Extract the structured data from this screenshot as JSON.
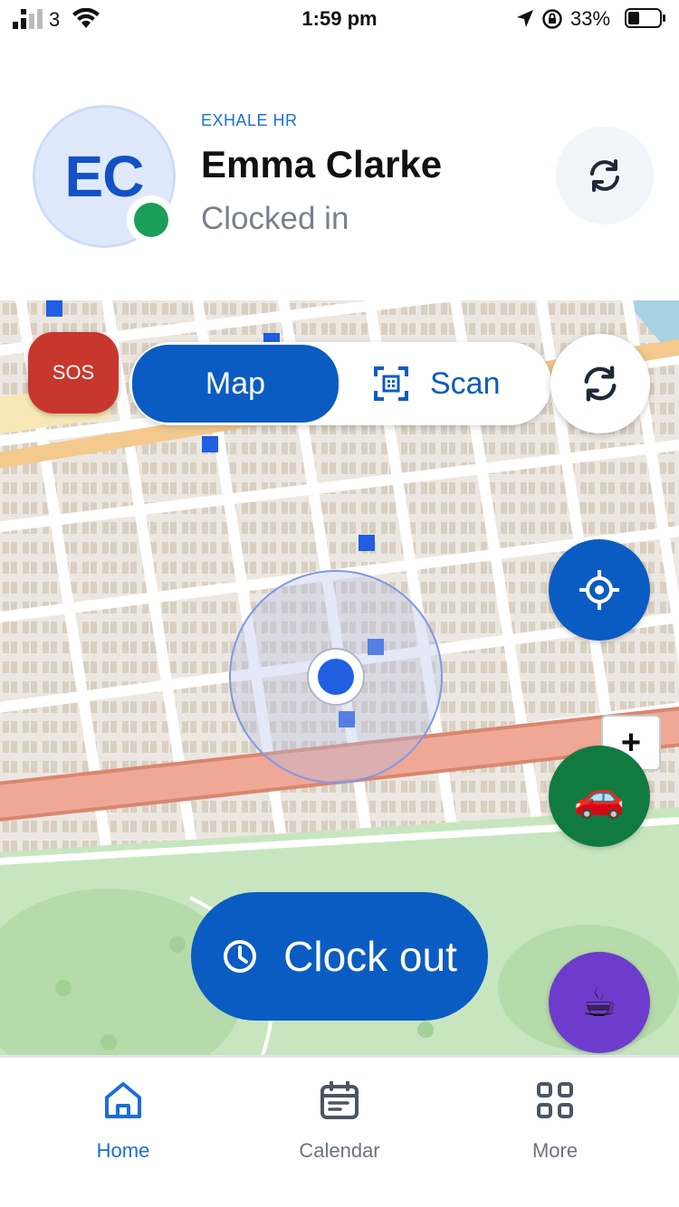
{
  "status_bar": {
    "carrier": "3",
    "time": "1:59 pm",
    "battery": "33%"
  },
  "profile": {
    "initials": "EC",
    "company": "EXHALE HR",
    "name": "Emma Clarke",
    "status": "Clocked in",
    "status_color": "#1b9e58"
  },
  "map_controls": {
    "sos": "SOS",
    "toggle": {
      "map_label": "Map",
      "scan_label": "Scan",
      "selected": "Map"
    },
    "zoom_in": "+",
    "car_icon": "🚗",
    "coffee_icon": "☕"
  },
  "actions": {
    "clock_out": "Clock out"
  },
  "nav": {
    "items": [
      {
        "label": "Home",
        "icon": "home-icon",
        "active": true
      },
      {
        "label": "Calendar",
        "icon": "calendar-icon",
        "active": false
      },
      {
        "label": "More",
        "icon": "grid-icon",
        "active": false
      }
    ]
  },
  "colors": {
    "primary": "#0b5cc2",
    "sos": "#c8372d",
    "car": "#117a40",
    "break": "#6e3ccc"
  }
}
